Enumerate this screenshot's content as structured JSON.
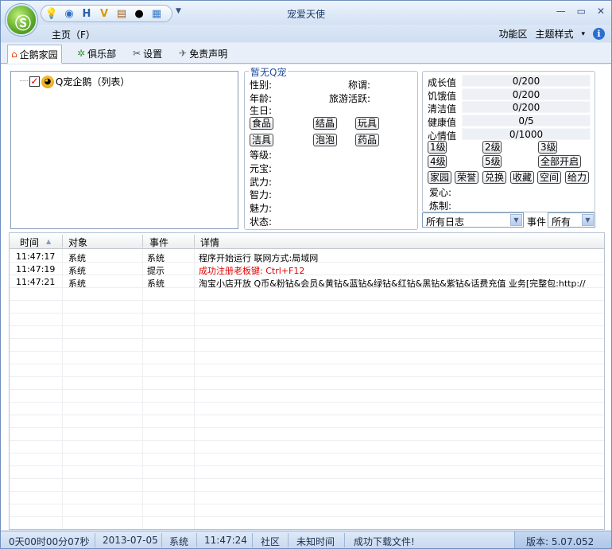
{
  "window": {
    "title": "宠爱天使"
  },
  "menu": {
    "home": "主页（F）",
    "function_area": "功能区",
    "theme": "主题样式",
    "theme_arrow": "▾"
  },
  "tabs": [
    {
      "label": "企鹅家园",
      "icon": "penguin-home-icon"
    },
    {
      "label": "俱乐部",
      "icon": "club-icon"
    },
    {
      "label": "设置",
      "icon": "tools-icon"
    },
    {
      "label": "免责声明",
      "icon": "satellite-icon"
    }
  ],
  "tree": {
    "root_label": "Q宠企鹅（列表）"
  },
  "pet": {
    "legend": "暂无Q宠",
    "gender": "性别:",
    "title": "称谓:",
    "age": "年龄:",
    "travel": "旅游活跃:",
    "birthday": "生日:",
    "btn_food": "食品",
    "btn_crystal": "结晶",
    "btn_toy": "玩具",
    "btn_clean": "洁具",
    "btn_bubble": "泡泡",
    "btn_medicine": "药品",
    "level": "等级:",
    "yuanbao": "元宝:",
    "force": "武力:",
    "intellect": "智力:",
    "charm": "魅力:",
    "status": "状态:"
  },
  "stats": {
    "growth_label": "成长值",
    "growth": "0/200",
    "hunger_label": "饥饿值",
    "hunger": "0/200",
    "clean_label": "清洁值",
    "clean": "0/200",
    "health_label": "健康值",
    "health": "0/5",
    "mood_label": "心情值",
    "mood": "0/1000",
    "lv1": "1级",
    "lv2": "2级",
    "lv3": "3级",
    "lv4": "4级",
    "lv5": "5级",
    "open_all": "全部开启",
    "home": "家园",
    "honor": "荣誉",
    "exchange": "兑换",
    "collect": "收藏",
    "space": "空间",
    "boost": "给力",
    "love": "爱心:",
    "refine": "炼制:"
  },
  "filters": {
    "log_select": "所有日志",
    "event_label": "事件",
    "event_select": "所有"
  },
  "log": {
    "columns": [
      "时间",
      "对象",
      "事件",
      "详情"
    ],
    "sort_arrow": "▲",
    "rows": [
      {
        "time": "11:47:17",
        "object": "系统",
        "event": "系统",
        "detail": "程序开始运行  联网方式:局域网",
        "color": "#000000"
      },
      {
        "time": "11:47:19",
        "object": "系统",
        "event": "提示",
        "detail": "成功注册老板键: Ctrl+F12",
        "color": "#e00000"
      },
      {
        "time": "11:47:21",
        "object": "系统",
        "event": "系统",
        "detail": "淘宝小店开放 Q币&粉钻&会员&黄钻&蓝钻&绿钻&红钻&黑钻&紫钻&话费充值 业务[完整包:http://",
        "color": "#000000"
      }
    ]
  },
  "statusbar": {
    "uptime": "0天00时00分07秒",
    "date": "2013-07-05",
    "system": "系统",
    "time": "11:47:24",
    "community": "社区",
    "unknown_time": "未知时间",
    "download": "成功下载文件!",
    "version": "版本: 5.07.052"
  }
}
